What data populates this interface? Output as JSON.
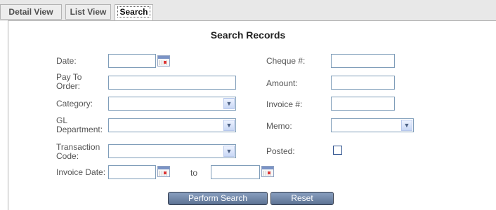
{
  "tabs": [
    {
      "label": "Detail View"
    },
    {
      "label": "List View"
    },
    {
      "label": "Search"
    }
  ],
  "title": "Search Records",
  "fields": {
    "date": {
      "label": "Date:",
      "value": ""
    },
    "pay_to_order": {
      "label": "Pay To Order:",
      "value": ""
    },
    "category": {
      "label": "Category:",
      "selected": ""
    },
    "gl_department": {
      "label": "GL Department:",
      "selected": ""
    },
    "transaction_code": {
      "label": "Transaction Code:",
      "selected": ""
    },
    "invoice_date": {
      "label": "Invoice Date:",
      "from": "",
      "to_label": "to",
      "to": ""
    },
    "cheque": {
      "label": "Cheque #:",
      "value": ""
    },
    "amount": {
      "label": "Amount:",
      "value": ""
    },
    "invoice": {
      "label": "Invoice #:",
      "value": ""
    },
    "memo": {
      "label": "Memo:",
      "selected": ""
    },
    "posted": {
      "label": "Posted:",
      "checked": false
    }
  },
  "buttons": {
    "search": "Perform Search",
    "reset": "Reset"
  },
  "icons": {
    "calendar": "calendar-icon",
    "dropdown": "chevron-down-icon"
  },
  "colors": {
    "button": "#6a7fa0",
    "input_border": "#7f9db9"
  }
}
